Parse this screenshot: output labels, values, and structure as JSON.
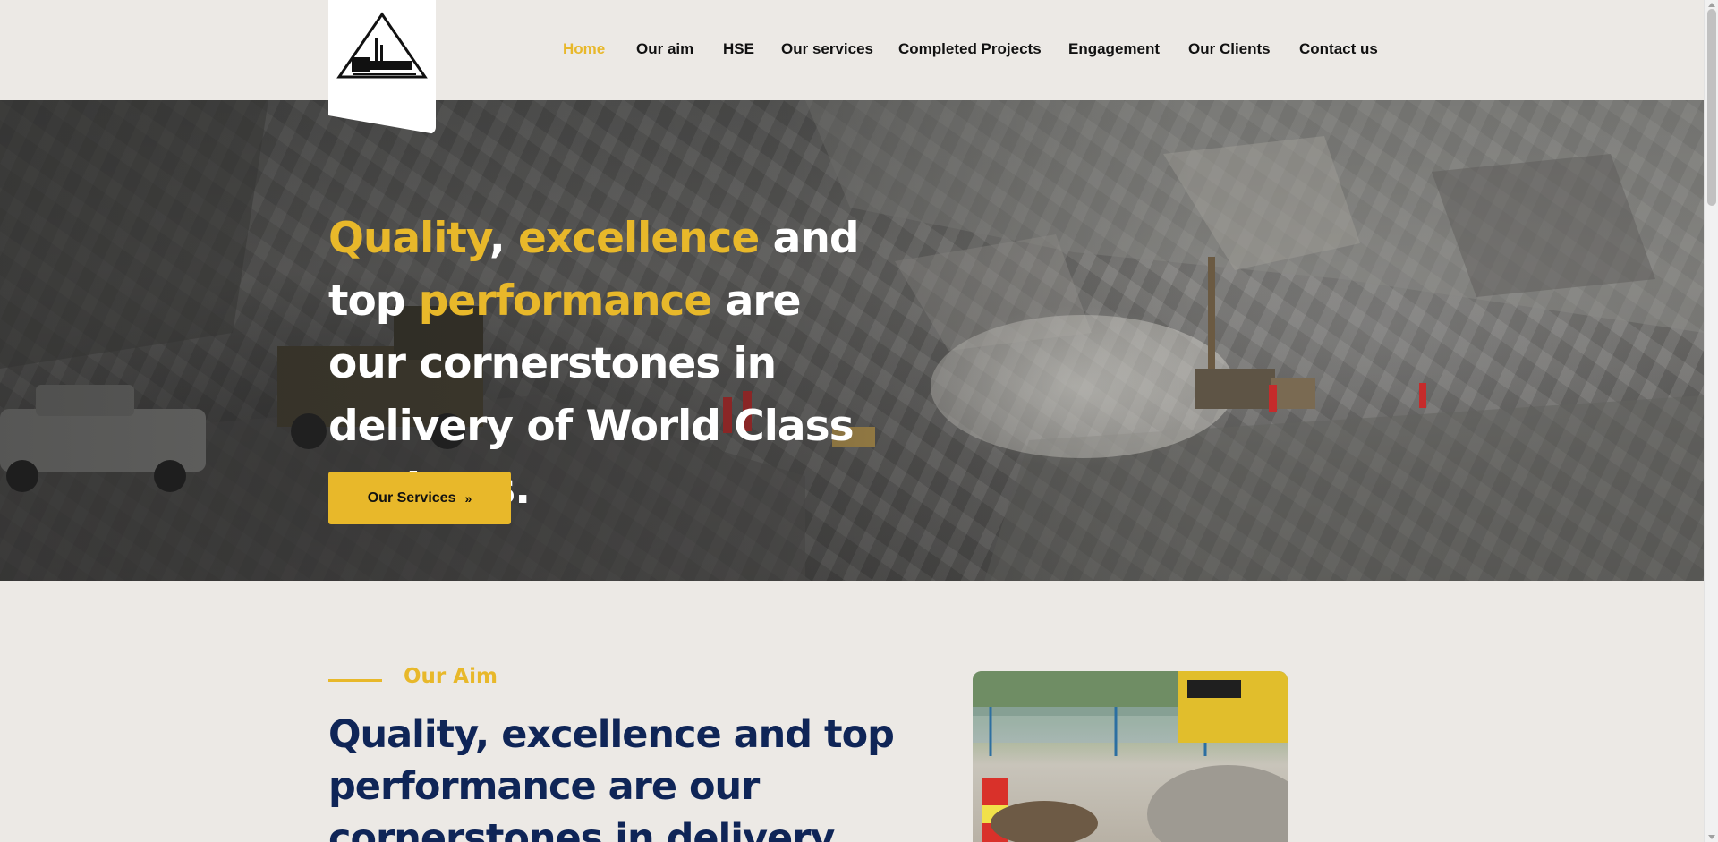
{
  "nav": {
    "items": [
      {
        "label": "Home",
        "active": true
      },
      {
        "label": "Our aim",
        "active": false
      },
      {
        "label": "HSE",
        "active": false
      },
      {
        "label": "Our services",
        "active": false
      },
      {
        "label": "Completed Projects",
        "active": false
      },
      {
        "label": "Engagement",
        "active": false
      },
      {
        "label": "Our Clients",
        "active": false
      },
      {
        "label": "Contact us",
        "active": false
      }
    ]
  },
  "hero": {
    "title_parts": {
      "quality": "Quality",
      "comma": ",",
      "excellence": "excellence",
      "and": "and",
      "top": "top",
      "performance": "performance",
      "rest": "are our cornerstones in delivery of World Class Projects."
    },
    "button_label": "Our Services",
    "button_icon": "double-chevron-right-icon"
  },
  "aim": {
    "label": "Our Aim",
    "title": "Quality, excellence and top performance are our cornerstones in delivery"
  },
  "colors": {
    "accent": "#e8b82a",
    "navy": "#0f2557",
    "background": "#ece9e5"
  }
}
